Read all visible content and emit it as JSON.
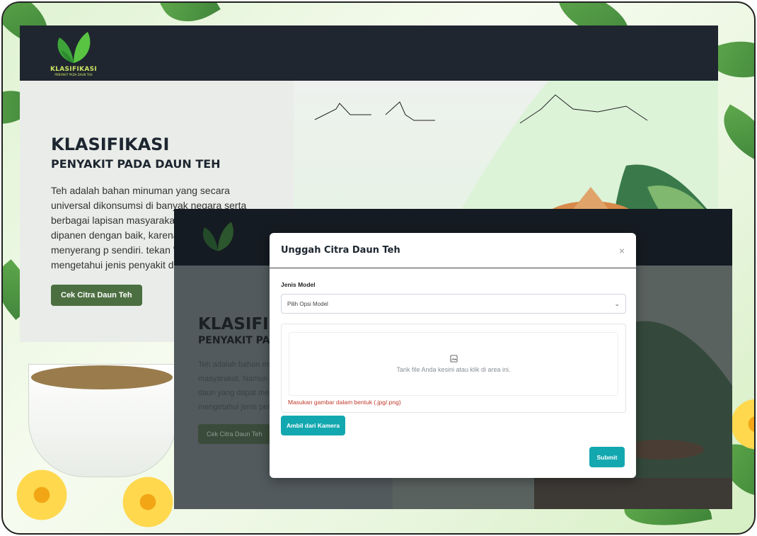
{
  "logo": {
    "name": "KLASIFIKASI",
    "tagline": "PENYAKIT PADA DAUN TEH"
  },
  "hero": {
    "title": "KLASIFIKASI",
    "subtitle": "PENYAKIT PADA DAUN TEH",
    "text": "Teh adalah bahan minuman yang secara universal dikonsumsi di banyak negara serta berbagai lapisan masyarakat. Namun daun teh dipanen dengan baik, karena a daun yang dapat menyerang p sendiri. tekan \"Cek Citra Daun mengetahui jenis penyakit dau inputkan.",
    "button": "Cek Citra Daun Teh"
  },
  "hero_dim": {
    "title": "KLASIFIKA",
    "subtitle": "PENYAKIT PADA",
    "text": "Teh adalah bahan min dikonsumsi di banyak masyarakat. Namun d dipanen dengan baik, daun yang dapat men sendiri. tekan \"Cek Cit mengetahui jenis peny inputkan.",
    "button": "Cek Citra Daun Teh"
  },
  "modal": {
    "title": "Unggah Citra Daun Teh",
    "close": "×",
    "model_label": "Jenis Model",
    "model_placeholder": "Pilih Opsi Model",
    "dropzone_text": "Tarik file Anda kesini atau klik di area ini.",
    "error_text": "Masukan gambar dalam bentuk (.jpg/.png)",
    "camera_button": "Ambil dari Kamera",
    "submit_button": "Submit"
  },
  "colors": {
    "navbar": "#1f262f",
    "primary_green": "#4c6f42",
    "teal": "#13a8b0",
    "error": "#c0392b"
  }
}
